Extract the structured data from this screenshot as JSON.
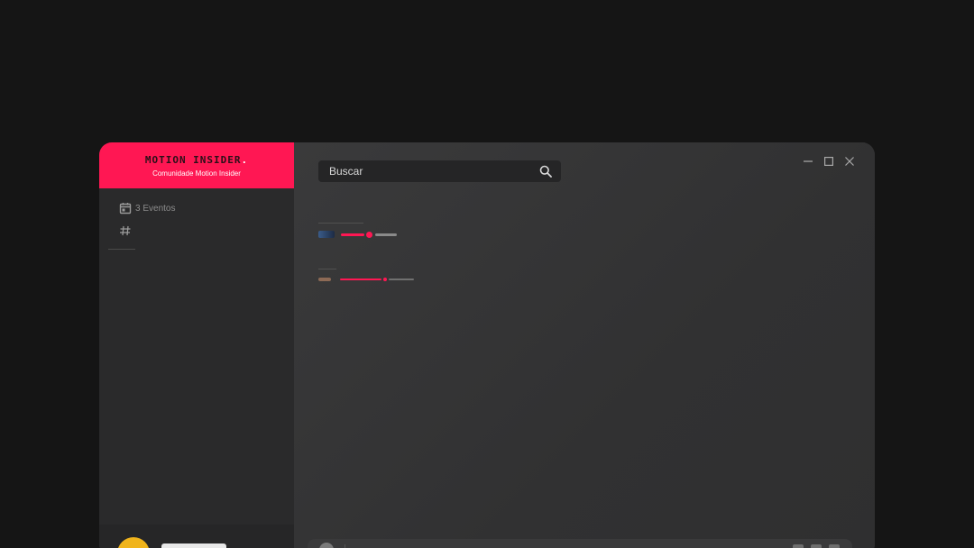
{
  "brand": {
    "logo_text": "MOTION INSIDER",
    "logo_dot": ".",
    "subtitle": "Comunidade Motion Insider",
    "color": "#ff1753"
  },
  "sidebar": {
    "items": [
      {
        "icon": "calendar-icon",
        "label": "3 Eventos"
      },
      {
        "icon": "hash-icon",
        "label": ""
      }
    ]
  },
  "search": {
    "placeholder": "Buscar",
    "icon": "search-icon"
  },
  "window_controls": [
    "minimize-icon",
    "maximize-icon",
    "close-icon"
  ],
  "colors": {
    "accent": "#ff1753",
    "window_bg": "#2e2e2f",
    "sidebar_bg": "#2a2a2b",
    "avatar": "#f0b41c"
  }
}
